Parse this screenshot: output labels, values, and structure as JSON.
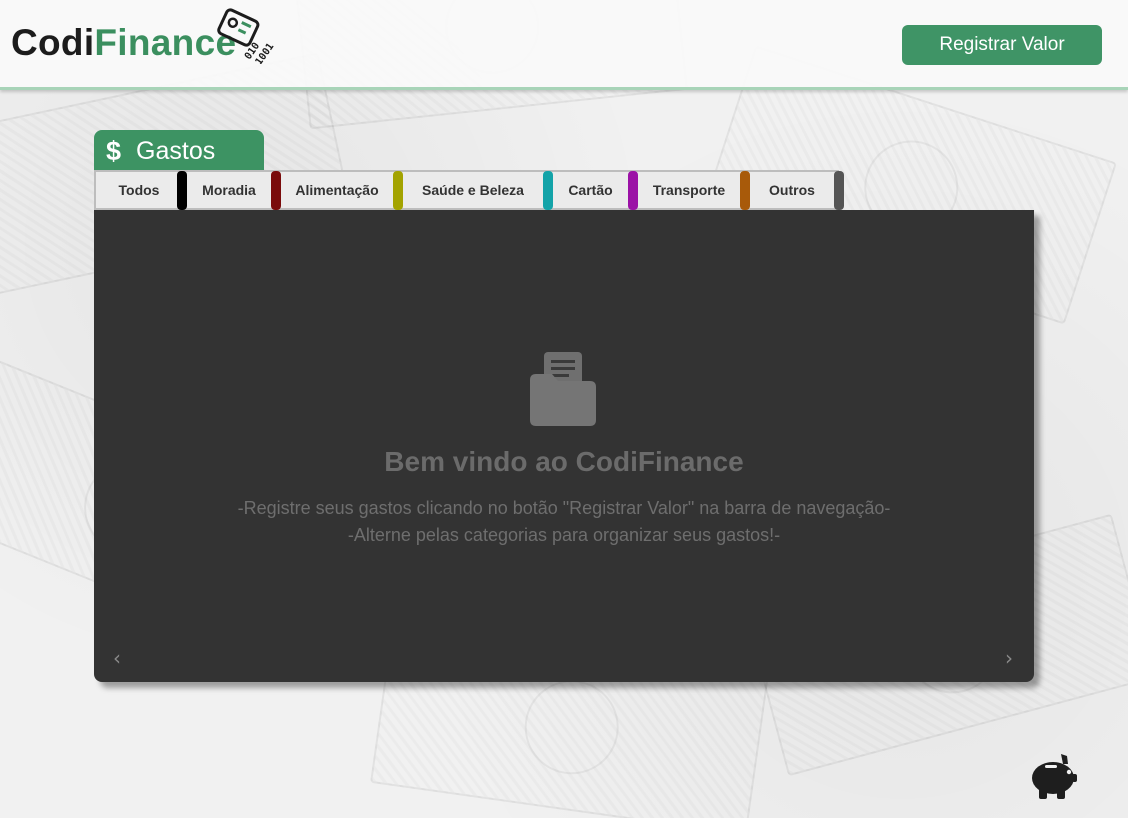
{
  "header": {
    "logo_part1": "Codi",
    "logo_part2": "Finance",
    "logo_mark_text": "010 1001",
    "register_button": "Registrar Valor"
  },
  "section": {
    "icon": "$",
    "title": "Gastos"
  },
  "categories": [
    {
      "label": "Todos",
      "color": "#000000"
    },
    {
      "label": "Moradia",
      "color": "#7a0b0b"
    },
    {
      "label": "Alimentação",
      "color": "#a3a300"
    },
    {
      "label": "Saúde e Beleza",
      "color": "#13a3a8"
    },
    {
      "label": "Cartão",
      "color": "#9b12a6"
    },
    {
      "label": "Transporte",
      "color": "#a85a0a"
    },
    {
      "label": "Outros",
      "color": "#555555"
    }
  ],
  "panel": {
    "icon": "folder-document-icon",
    "welcome": "Bem vindo ao CodiFinance",
    "hint_line1": "-Registre seus gastos clicando no botão \"Registrar Valor\" na barra de navegação-",
    "hint_line2": "-Alterne pelas categorias para organizar seus gastos!-",
    "prev_arrow": "‹",
    "next_arrow": "›"
  },
  "floating": {
    "icon": "piggy-bank-icon"
  },
  "colors": {
    "brand_green": "#3d9363",
    "panel_bg": "#333333"
  }
}
